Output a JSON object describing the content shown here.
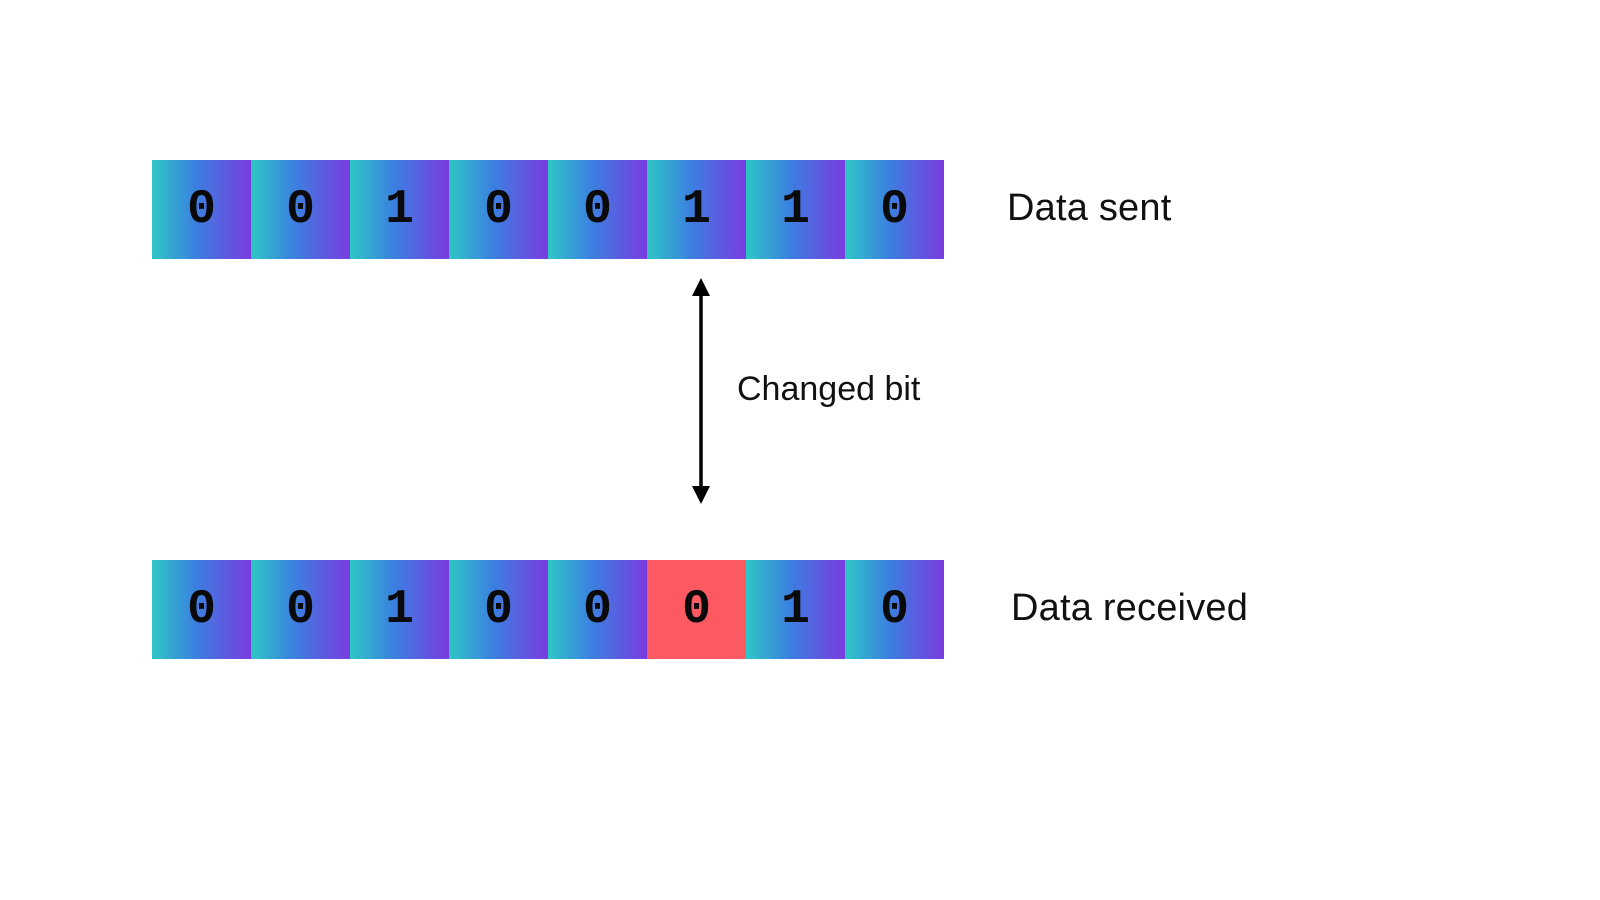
{
  "rows": {
    "sent": {
      "label": "Data sent",
      "bits": [
        "0",
        "0",
        "1",
        "0",
        "0",
        "1",
        "1",
        "0"
      ],
      "changedIndex": -1
    },
    "received": {
      "label": "Data  received",
      "bits": [
        "0",
        "0",
        "1",
        "0",
        "0",
        "0",
        "1",
        "0"
      ],
      "changedIndex": 5
    }
  },
  "arrow": {
    "label": "Changed bit"
  },
  "colors": {
    "gradientStart": "#2ec6c6",
    "gradientEnd": "#7a3be0",
    "error": "#fb5a62"
  }
}
